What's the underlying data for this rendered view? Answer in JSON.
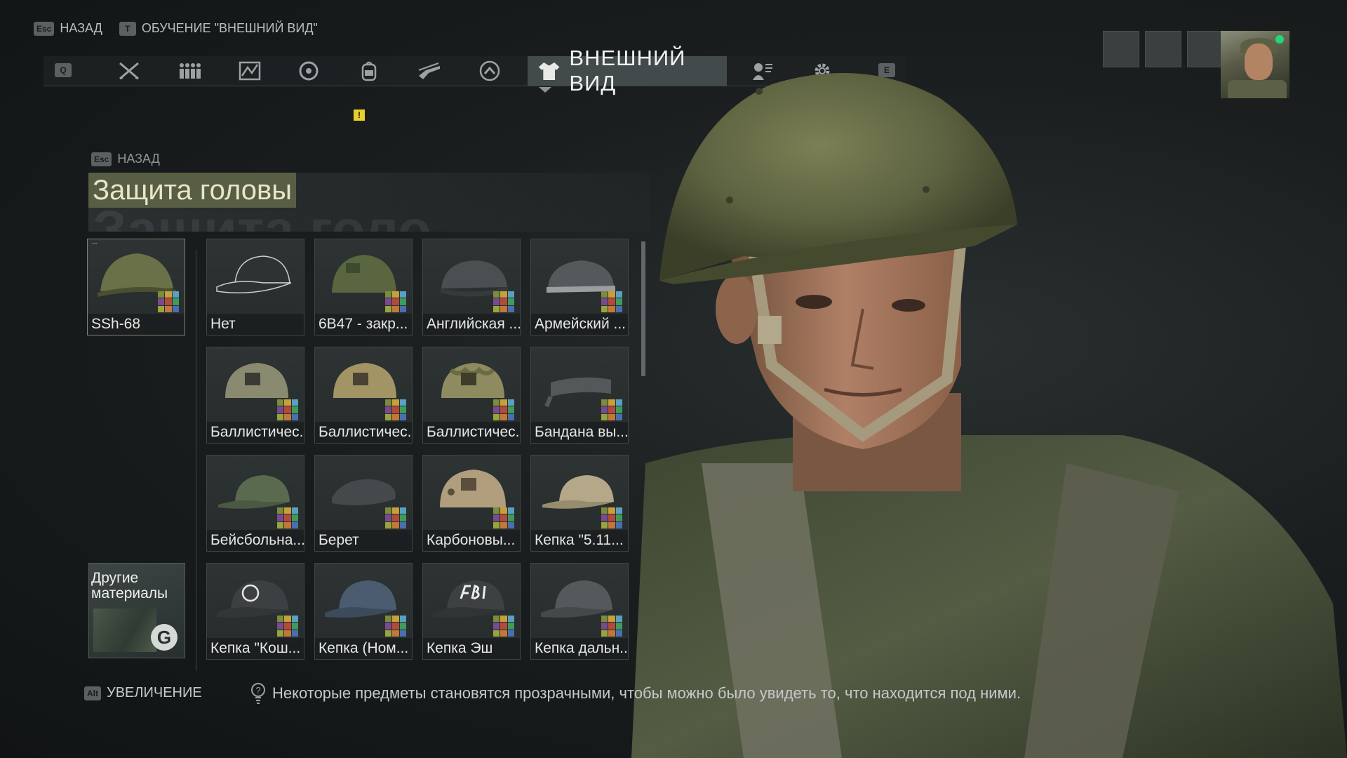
{
  "top_hints": [
    {
      "key": "Esc",
      "label": "НАЗАД"
    },
    {
      "key": "T",
      "label": "ОБУЧЕНИЕ \"ВНЕШНИЙ ВИД\""
    }
  ],
  "tabbar": {
    "left_key": "Q",
    "right_key": "E",
    "icons": [
      "crossed-weapons-icon",
      "squad-icon",
      "map-icon",
      "target-icon",
      "backpack-icon",
      "rifle-icon",
      "rank-icon"
    ],
    "active_tab_label": "ВНЕШНИЙ ВИД",
    "trailing_icons": [
      "profile-icon",
      "settings-icon"
    ],
    "badge": "!"
  },
  "panel": {
    "back_key": "Esc",
    "back_label": "НАЗАД",
    "title": "Защита головы",
    "title_ghost": "Защита голо",
    "equipped": {
      "label": "SSh-68"
    },
    "items": [
      {
        "label": "Нет"
      },
      {
        "label": "6B47 - закр..."
      },
      {
        "label": "Английская ..."
      },
      {
        "label": "Армейский ..."
      },
      {
        "label": "Баллистичес..."
      },
      {
        "label": "Баллистичес..."
      },
      {
        "label": "Баллистичес..."
      },
      {
        "label": "Бандана вы..."
      },
      {
        "label": "Бейсбольна..."
      },
      {
        "label": "Берет"
      },
      {
        "label": "Карбоновы..."
      },
      {
        "label": "Кепка \"5.11..."
      },
      {
        "label": "Кепка \"Кош..."
      },
      {
        "label": "Кепка (Ном..."
      },
      {
        "label": "Кепка Эш"
      },
      {
        "label": "Кепка дальн..."
      }
    ],
    "other_materials_label": "Другие материалы"
  },
  "bottom": {
    "zoom_key": "Alt",
    "zoom_label": "УВЕЛИЧЕНИЕ",
    "tip": "Некоторые предметы становятся прозрачными, чтобы можно было увидеть то, что находится под ними."
  },
  "colors": {
    "title_bg": "#585e43",
    "online": "#22d67a",
    "badge": "#e8cf2a"
  }
}
